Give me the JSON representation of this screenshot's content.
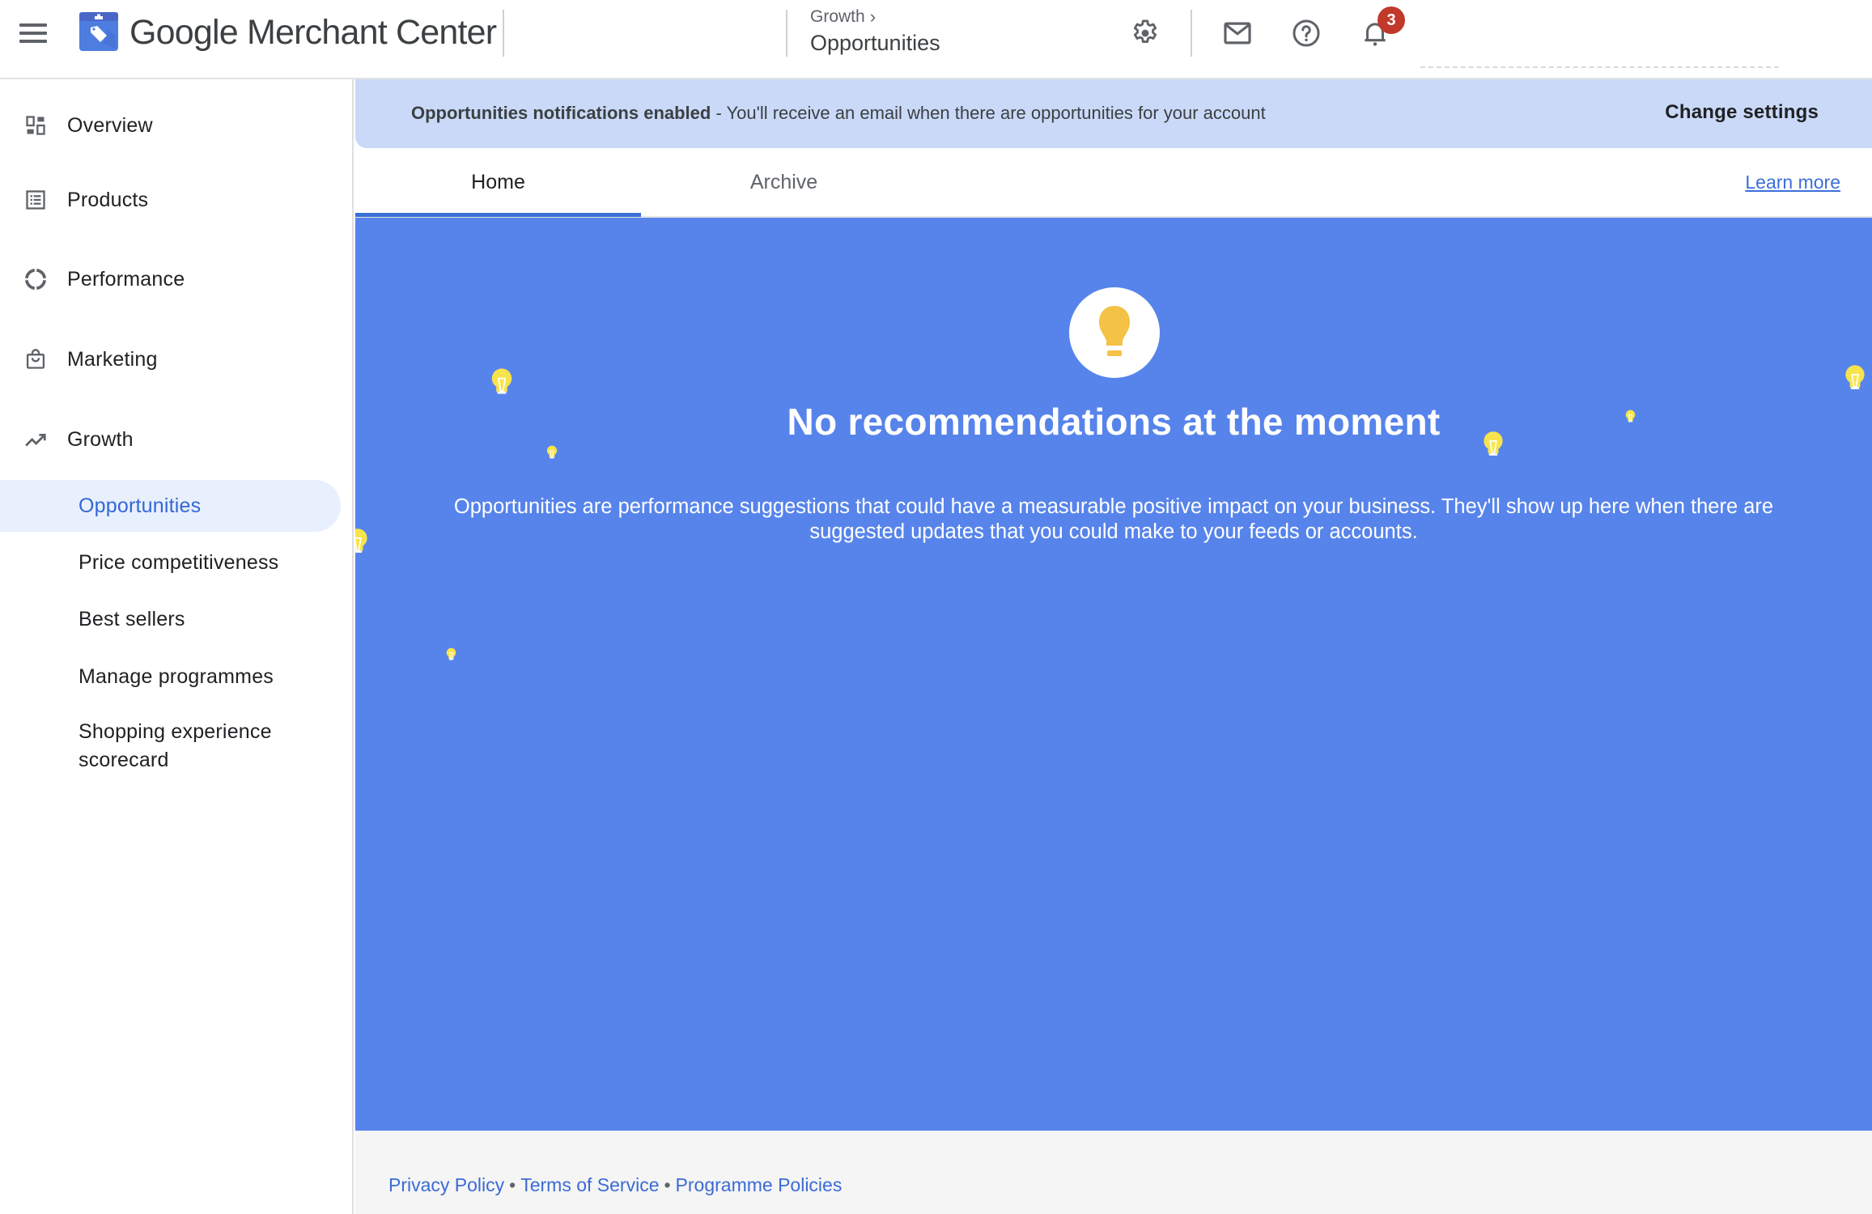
{
  "header": {
    "menu_icon": "hamburger-menu-icon",
    "logo_icon": "merchant-center-tag-logo",
    "app_title": "Google Merchant Center",
    "breadcrumb_parent": "Growth",
    "breadcrumb_chevron": "›",
    "breadcrumb_current": "Opportunities",
    "icons": [
      "gear-icon",
      "mail-icon",
      "help-icon",
      "bell-icon"
    ],
    "notification_count": "3",
    "badge_color": "#c0392b"
  },
  "sidebar": {
    "items": [
      {
        "label": "Overview",
        "icon": "dashboard-icon"
      },
      {
        "label": "Products",
        "icon": "list-icon"
      },
      {
        "label": "Performance",
        "icon": "donut-chart-icon"
      },
      {
        "label": "Marketing",
        "icon": "shopping-bag-icon"
      },
      {
        "label": "Growth",
        "icon": "trending-up-icon"
      }
    ],
    "sub_items": [
      {
        "label": "Opportunities",
        "active": true
      },
      {
        "label": "Price competitiveness",
        "active": false
      },
      {
        "label": "Best sellers",
        "active": false
      },
      {
        "label": "Manage programmes",
        "active": false
      },
      {
        "label": "Shopping experience scorecard",
        "active": false
      }
    ]
  },
  "banner": {
    "bold_text": "Opportunities notifications enabled",
    "text": " - You'll receive an email when there are opportunities for your account",
    "action_label": "Change settings"
  },
  "tabs": {
    "items": [
      {
        "label": "Home",
        "active": true
      },
      {
        "label": "Archive",
        "active": false
      }
    ],
    "learn_more": "Learn more"
  },
  "empty_state": {
    "icon": "lightbulb-icon",
    "title": "No recommendations at the moment",
    "description": "Opportunities are performance suggestions that could have a measurable positive impact on your business. They'll show up here when there are suggested updates that you could make to your feeds or accounts."
  },
  "footer": {
    "links": [
      "Privacy Policy",
      "Terms of Service",
      "Programme Policies"
    ],
    "separator": "•"
  },
  "colors": {
    "accent": "#3a6fd8",
    "hero_background": "#5784eb",
    "banner_background": "#c9d9f7",
    "active_nav_background": "#e8f0fe",
    "bulb_yellow": "#f4c244",
    "decor_bulb_yellow": "#f7e44d"
  }
}
